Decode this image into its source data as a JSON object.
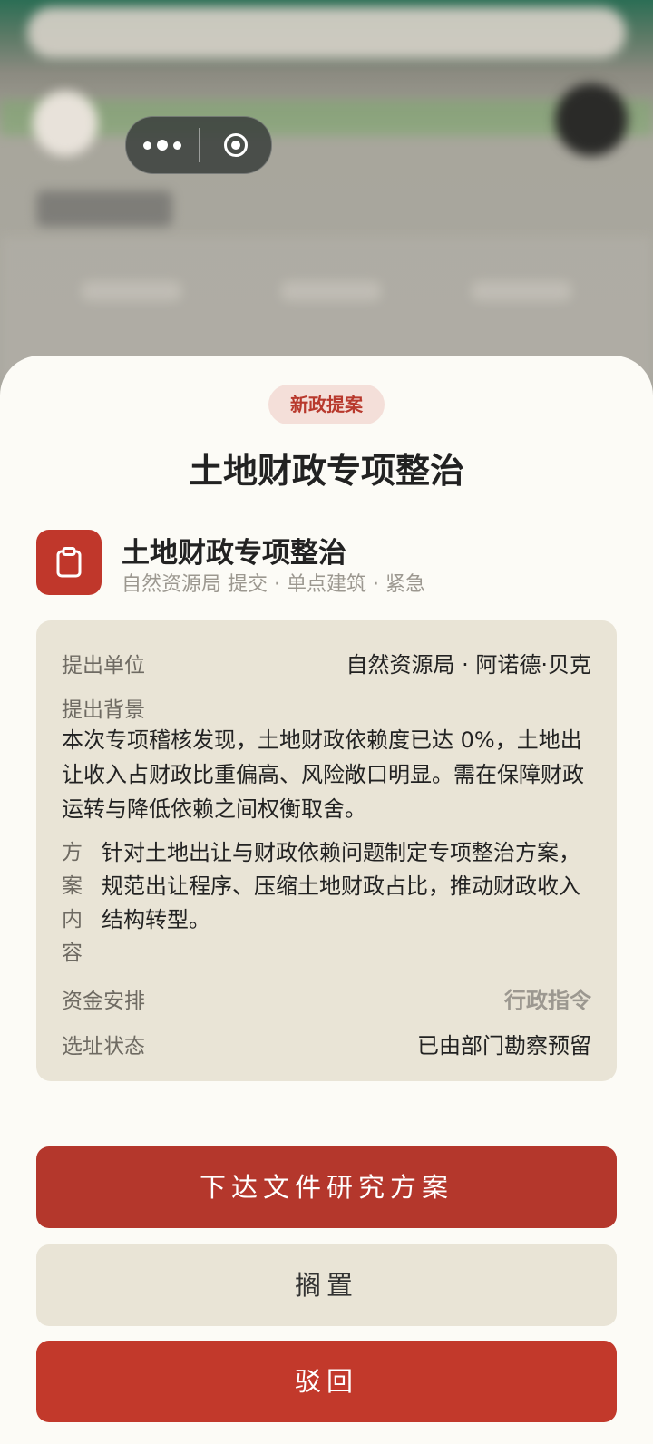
{
  "colors": {
    "accent": "#b4372c",
    "tag_bg": "#f4dfd9",
    "card_bg": "#e9e4d6",
    "sheet_bg": "#fcfbf6"
  },
  "capsule": {
    "more_icon": "more-dots-icon",
    "close_icon": "target-circle-icon"
  },
  "sheet": {
    "tag": "新政提案",
    "title": "土地财政专项整治"
  },
  "proposal": {
    "icon": "clipboard-icon",
    "name": "土地财政专项整治",
    "meta": "自然资源局 提交 · 单点建筑 · 紧急"
  },
  "details": {
    "unit_label": "提出单位",
    "unit_value": "自然资源局 · 阿诺德·贝克",
    "background_label": "提出背景",
    "background_text": "本次专项稽核发现，土地财政依赖度已达 0%，土地出让收入占财政比重偏高、风险敞口明显。需在保障财政运转与降低依赖之间权衡取舍。",
    "plan_label": "方案内容",
    "plan_text": "针对土地出让与财政依赖问题制定专项整治方案，规范出让程序、压缩土地财政占比，推动财政收入结构转型。",
    "funding_label": "资金安排",
    "funding_value": "行政指令",
    "site_label": "选址状态",
    "site_value": "已由部门勘察预留"
  },
  "actions": {
    "primary": "下达文件研究方案",
    "shelve": "搁置",
    "reject": "驳回"
  }
}
